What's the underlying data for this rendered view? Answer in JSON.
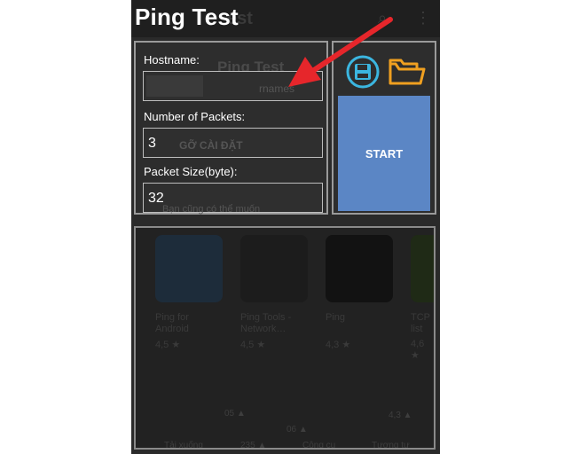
{
  "app": {
    "title": "Ping Test",
    "ghost_title": "est",
    "ghost_search": "⌕",
    "ghost_menu": "⋮"
  },
  "form": {
    "hostname_label": "Hostname:",
    "hostname_value": "",
    "ghost_ping_test": "Ping Test",
    "ghost_names": "rnames",
    "packets_label": "Number of Packets:",
    "packets_value": "3",
    "ghost_install": "GỠ CÀI ĐẶT",
    "size_label": "Packet Size(byte):",
    "size_value": "32",
    "ghost_more": "Bạn cũng có thể muốn"
  },
  "actions": {
    "start_label": "START"
  },
  "colors": {
    "save_icon": "#3bb6e0",
    "folder_icon": "#f0a020",
    "start_button": "#5b86c5",
    "arrow": "#e6262b"
  },
  "icons": {
    "save": "save-icon",
    "folder": "folder-icon"
  },
  "ghost_apps": [
    {
      "name1": "Ping for",
      "name2": "Android",
      "rating": "4,5 ★"
    },
    {
      "name1": "Ping Tools -",
      "name2": "Network…",
      "rating": "4,5 ★"
    },
    {
      "name1": "Ping",
      "name2": "",
      "rating": "4,3 ★"
    },
    {
      "name1": "TCP",
      "name2": "list",
      "rating": "4,6 ★"
    }
  ],
  "ghost_footer": {
    "n1": "05 ▲",
    "n2": "06 ▲",
    "n3": "4,3 ▲",
    "t1": "Tải xuống",
    "t2": "235 ▲",
    "t3": "Công cụ",
    "t4": "Tương tự"
  }
}
